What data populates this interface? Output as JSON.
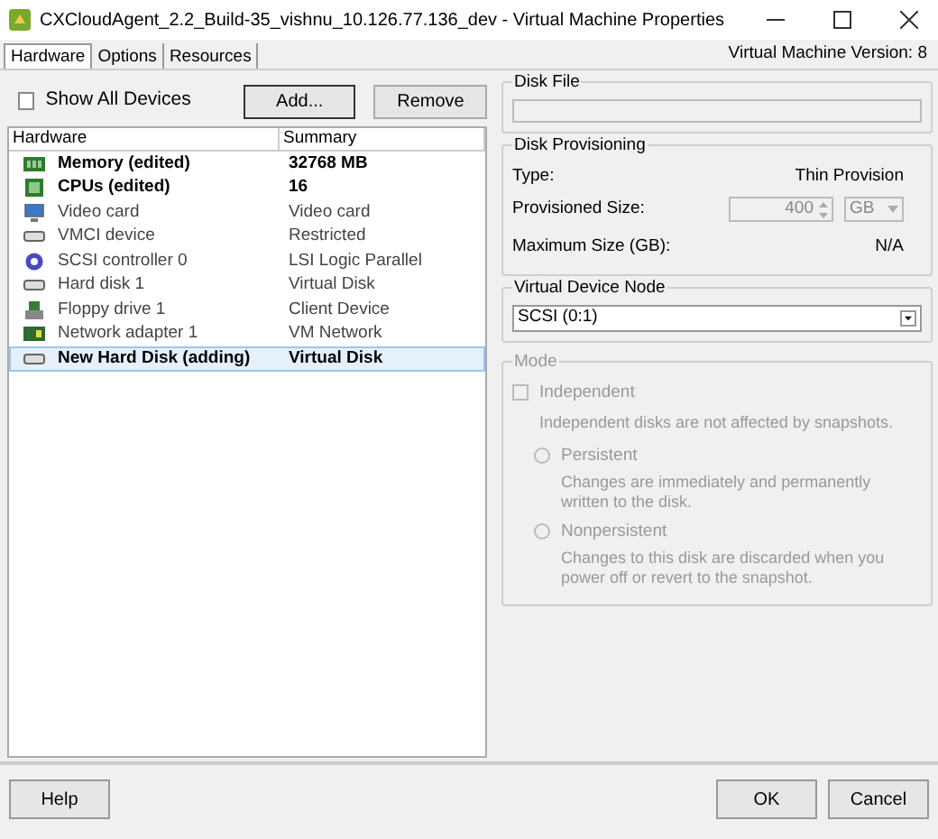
{
  "window": {
    "title": "CXCloudAgent_2.2_Build-35_vishnu_10.126.77.136_dev - Virtual Machine Properties"
  },
  "tabs": [
    {
      "label": "Hardware",
      "selected": true
    },
    {
      "label": "Options",
      "selected": false
    },
    {
      "label": "Resources",
      "selected": false
    }
  ],
  "vm_version": "Virtual Machine Version: 8",
  "show_all_devices": {
    "label": "Show All Devices",
    "checked": false
  },
  "toolbar_buttons": [
    "Add...",
    "Remove"
  ],
  "table": {
    "columns": [
      "Hardware",
      "Summary"
    ],
    "rows": [
      {
        "kind": "memory",
        "hardware": "Memory (edited)",
        "summary": "32768 MB",
        "bold": true,
        "selected": false
      },
      {
        "kind": "cpu",
        "hardware": "CPUs (edited)",
        "summary": "16",
        "bold": true,
        "selected": false
      },
      {
        "kind": "video",
        "hardware": "Video card",
        "summary": "Video card",
        "bold": false,
        "selected": false
      },
      {
        "kind": "disk",
        "hardware": "VMCI device",
        "summary": "Restricted",
        "bold": false,
        "selected": false
      },
      {
        "kind": "scsi",
        "hardware": "SCSI controller 0",
        "summary": "LSI Logic Parallel",
        "bold": false,
        "selected": false
      },
      {
        "kind": "disk",
        "hardware": "Hard disk 1",
        "summary": "Virtual Disk",
        "bold": false,
        "selected": false
      },
      {
        "kind": "floppy",
        "hardware": "Floppy drive 1",
        "summary": "Client Device",
        "bold": false,
        "selected": false
      },
      {
        "kind": "network",
        "hardware": "Network adapter 1",
        "summary": "VM Network",
        "bold": false,
        "selected": false
      },
      {
        "kind": "disk",
        "hardware": "New Hard Disk (adding)",
        "summary": "Virtual Disk",
        "bold": true,
        "selected": true
      }
    ]
  },
  "disk_file": {
    "title": "Disk File"
  },
  "disk_provisioning": {
    "title": "Disk Provisioning",
    "type_label": "Type:",
    "type_value": "Thin Provision",
    "size_label": "Provisioned Size:",
    "size_value": "400",
    "size_unit": "GB",
    "max_label": "Maximum Size (GB):",
    "max_value": "N/A"
  },
  "virtual_device_node": {
    "title": "Virtual Device Node",
    "value": "SCSI (0:1)"
  },
  "mode": {
    "title": "Mode",
    "independent": {
      "label": "Independent",
      "checked": false
    },
    "independent_note": "Independent disks are not affected by snapshots.",
    "options": [
      {
        "label": "Persistent",
        "note": "Changes are immediately and permanently written to the disk.",
        "selected": false
      },
      {
        "label": "Nonpersistent",
        "note": "Changes to this disk are discarded when you power off or revert to the snapshot.",
        "selected": false
      }
    ]
  },
  "footer_buttons": [
    {
      "label": "Help",
      "kind": "left"
    },
    {
      "label": "OK",
      "kind": "right"
    },
    {
      "label": "Cancel",
      "kind": "right"
    }
  ]
}
